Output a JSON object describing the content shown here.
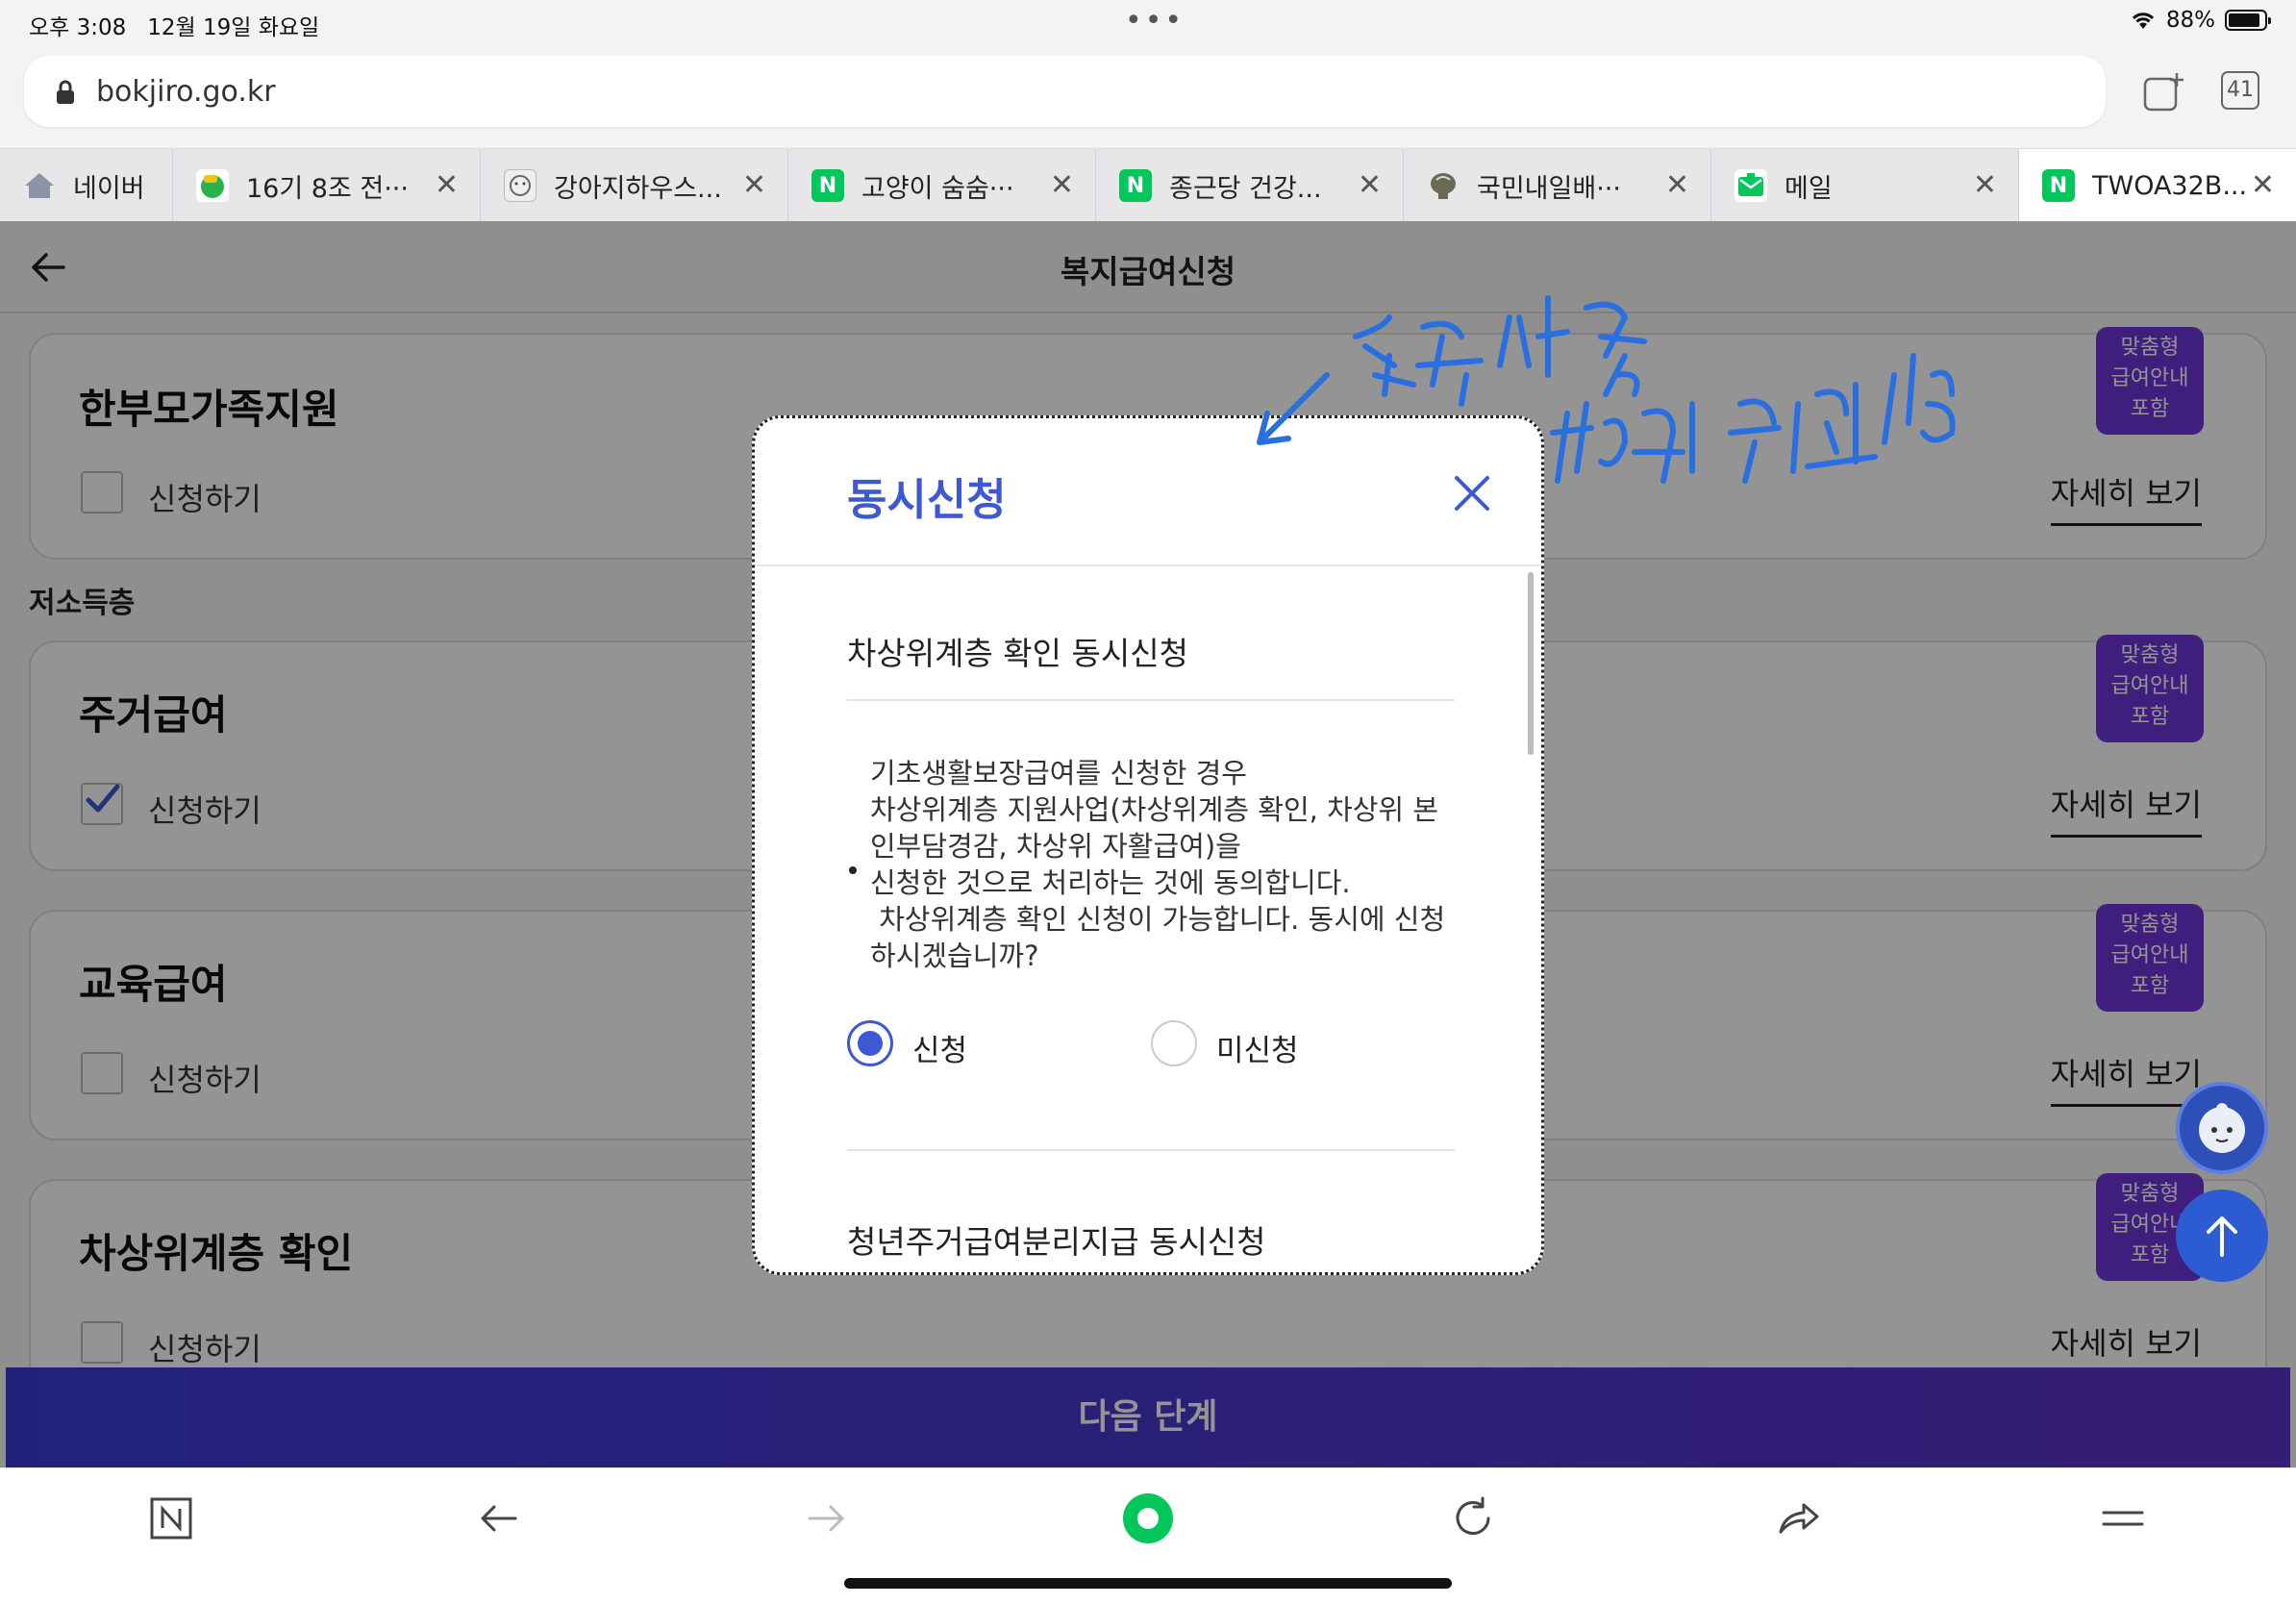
{
  "status_bar": {
    "time": "오후 3:08",
    "date": "12월 19일 화요일",
    "battery": "88%",
    "battery_level": 0.88
  },
  "browser": {
    "url": "bokjiro.go.kr",
    "tab_count": "41",
    "tabs": [
      {
        "title": "네이버",
        "icon": "home-icon"
      },
      {
        "title": "16기 8조 전···",
        "icon": "green-cup-icon"
      },
      {
        "title": "강아지하우스...",
        "icon": "dog-icon"
      },
      {
        "title": "고양이 숨숨···",
        "icon": "naver-n-icon"
      },
      {
        "title": "종근당 건강...",
        "icon": "naver-n-icon"
      },
      {
        "title": "국민내일배···",
        "icon": "brain-icon"
      },
      {
        "title": "메일",
        "icon": "mail-icon"
      },
      {
        "title": "TWOA32B...",
        "icon": "naver-n-icon"
      }
    ]
  },
  "page": {
    "title": "복지급여신청",
    "section_low_income": "저소득층",
    "apply_label": "신청하기",
    "detail_label": "자세히 보기",
    "badge_lines": [
      "맞춤형",
      "급여안내",
      "포함"
    ],
    "cards": [
      {
        "title": "한부모가족지원",
        "checked": false
      },
      {
        "title": "주거급여",
        "checked": true
      },
      {
        "title": "교육급여",
        "checked": false
      },
      {
        "title": "차상위계층 확인",
        "checked": false
      }
    ],
    "next_button": "다음 단계"
  },
  "modal": {
    "title": "동시신청",
    "section1_title": "차상위계층 확인 동시신청",
    "body_lines": [
      "기초생활보장급여를 신청한 경우",
      "차상위계층 지원사업(차상위계층 확인, 차상위 본",
      "인부담경감, 차상위 자활급여)을",
      "신청한 것으로 처리하는 것에 동의합니다.",
      " 차상위계층 확인 신청이 가능합니다. 동시에 신청",
      "하시겠습니까?"
    ],
    "option_apply": "신청",
    "option_not_apply": "미신청",
    "selected": "신청",
    "section2_title": "청년주거급여분리지급 동시신청"
  },
  "colors": {
    "accent": "#3c58d2",
    "badge": "#6d35d8",
    "naver_green": "#03c75a",
    "handwriting": "#2a6fe0"
  }
}
